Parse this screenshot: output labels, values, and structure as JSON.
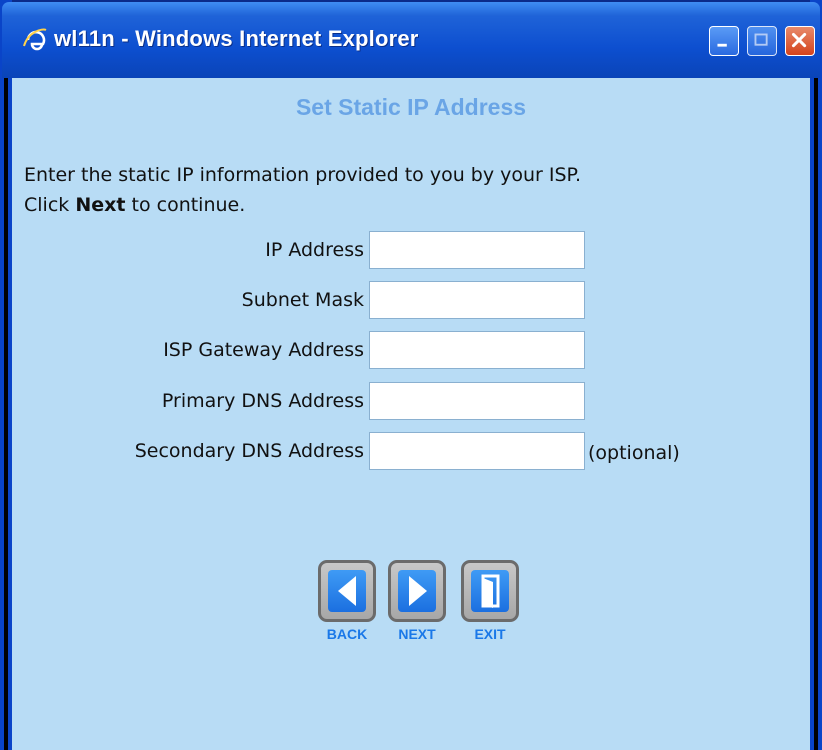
{
  "window": {
    "title": "wl11n - Windows Internet Explorer",
    "icon": "ie-logo-icon",
    "controls": [
      "minimize-icon",
      "maximize-icon",
      "close-icon"
    ]
  },
  "page": {
    "heading": "Set Static IP Address",
    "instruction_line1": "Enter the static IP information provided to you by your ISP.",
    "instruction_line2_prefix": "Click ",
    "instruction_line2_bold": "Next",
    "instruction_line2_suffix": " to continue."
  },
  "form": {
    "fields": [
      {
        "label": "IP Address",
        "value": ""
      },
      {
        "label": "Subnet Mask",
        "value": ""
      },
      {
        "label": "ISP Gateway Address",
        "value": ""
      },
      {
        "label": "Primary DNS Address",
        "value": ""
      },
      {
        "label": "Secondary DNS Address",
        "value": "",
        "note": "(optional)"
      }
    ]
  },
  "nav": {
    "back_label": "BACK",
    "next_label": "NEXT",
    "exit_label": "EXIT"
  },
  "colors": {
    "content_bg": "#b8dcf5",
    "heading": "#6aa5e6",
    "nav_label": "#1a78e8",
    "titlebar": "#0d4fd0"
  }
}
